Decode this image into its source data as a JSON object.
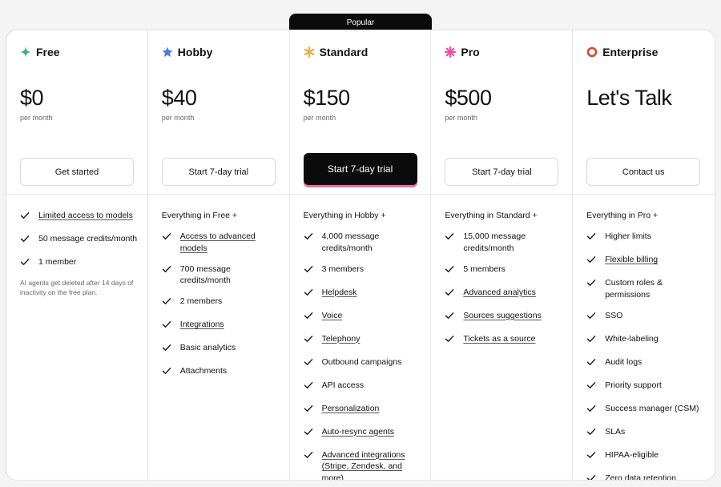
{
  "popular_label": "Popular",
  "plans": [
    {
      "name": "Free",
      "icon": "sparkle-icon",
      "icon_color": "#3cb371",
      "price": "$0",
      "per": "per month",
      "cta": "Get started",
      "primary": false,
      "heading": "",
      "features": [
        {
          "text": "Limited access to models",
          "u": true
        },
        {
          "text": "50 message credits/month",
          "u": false
        },
        {
          "text": "1 member",
          "u": false
        }
      ],
      "note": "AI agents get deleted after 14 days of inactivity on the free plan."
    },
    {
      "name": "Hobby",
      "icon": "star-icon",
      "icon_color": "#4a7be6",
      "price": "$40",
      "per": "per month",
      "cta": "Start 7-day trial",
      "primary": false,
      "heading": "Everything in Free +",
      "features": [
        {
          "text": "Access to advanced models",
          "u": true
        },
        {
          "text": "700 message credits/month",
          "u": false
        },
        {
          "text": "2 members",
          "u": false
        },
        {
          "text": "Integrations",
          "u": true
        },
        {
          "text": "Basic analytics",
          "u": false
        },
        {
          "text": "Attachments",
          "u": false
        }
      ]
    },
    {
      "name": "Standard",
      "icon": "asterisk-icon",
      "icon_color": "#f2a93b",
      "price": "$150",
      "per": "per month",
      "cta": "Start 7-day trial",
      "primary": true,
      "heading": "Everything in Hobby +",
      "features": [
        {
          "text": "4,000 message credits/month",
          "u": false
        },
        {
          "text": "3 members",
          "u": false
        },
        {
          "text": "Helpdesk",
          "u": true
        },
        {
          "text": "Voice",
          "u": true
        },
        {
          "text": "Telephony",
          "u": true
        },
        {
          "text": "Outbound campaigns",
          "u": false
        },
        {
          "text": "API access",
          "u": false
        },
        {
          "text": "Personalization",
          "u": true
        },
        {
          "text": "Auto-resync agents",
          "u": true
        },
        {
          "text": "Advanced integrations (Stripe, Zendesk, and more)",
          "u": true
        }
      ]
    },
    {
      "name": "Pro",
      "icon": "burst-icon",
      "icon_color": "#ec4fa4",
      "price": "$500",
      "per": "per month",
      "cta": "Start 7-day trial",
      "primary": false,
      "heading": "Everything in Standard +",
      "features": [
        {
          "text": "15,000 message credits/month",
          "u": false
        },
        {
          "text": "5 members",
          "u": false
        },
        {
          "text": "Advanced analytics",
          "u": true
        },
        {
          "text": "Sources suggestions",
          "u": true
        },
        {
          "text": "Tickets as a source",
          "u": true
        }
      ]
    },
    {
      "name": "Enterprise",
      "icon": "ring-icon",
      "icon_color": "#e0452f",
      "price": "Let's Talk",
      "per": "",
      "cta": "Contact us",
      "primary": false,
      "heading": "Everything in Pro +",
      "features": [
        {
          "text": "Higher limits",
          "u": false
        },
        {
          "text": "Flexible billing",
          "u": true
        },
        {
          "text": "Custom roles & permissions",
          "u": false
        },
        {
          "text": "SSO",
          "u": false
        },
        {
          "text": "White-labeling",
          "u": false
        },
        {
          "text": "Audit logs",
          "u": false
        },
        {
          "text": "Priority support",
          "u": false
        },
        {
          "text": "Success manager (CSM)",
          "u": false
        },
        {
          "text": "SLAs",
          "u": false
        },
        {
          "text": "HIPAA-eligible",
          "u": false
        },
        {
          "text": "Zero data retention",
          "u": false
        }
      ]
    }
  ]
}
